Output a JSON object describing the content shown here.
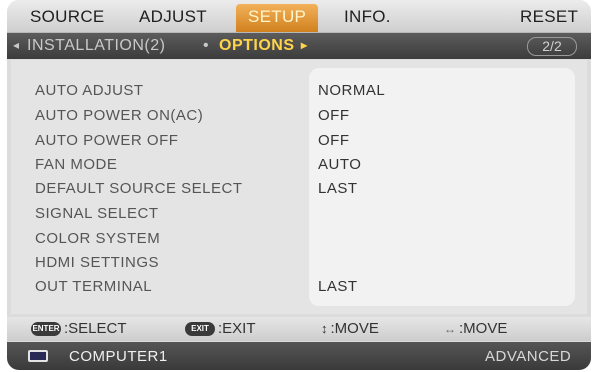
{
  "tabs": [
    "SOURCE",
    "ADJUST",
    "SETUP",
    "INFO.",
    "RESET"
  ],
  "active_tab": "SETUP",
  "subnav": {
    "left_arrow": "◂",
    "prev": "INSTALLATION(2)",
    "dot": "•",
    "current": "OPTIONS",
    "right_arrow": "▸",
    "page": "2/2"
  },
  "settings": [
    {
      "label": "AUTO ADJUST",
      "value": "NORMAL"
    },
    {
      "label": "AUTO POWER ON(AC)",
      "value": "OFF"
    },
    {
      "label": "AUTO POWER OFF",
      "value": "OFF"
    },
    {
      "label": "FAN MODE",
      "value": "AUTO"
    },
    {
      "label": "DEFAULT SOURCE SELECT",
      "value": "LAST"
    },
    {
      "label": "SIGNAL SELECT",
      "value": ""
    },
    {
      "label": "COLOR SYSTEM",
      "value": ""
    },
    {
      "label": "HDMI SETTINGS",
      "value": ""
    },
    {
      "label": "OUT TERMINAL",
      "value": "LAST"
    }
  ],
  "help": {
    "enter_key": "ENTER",
    "select": ":SELECT",
    "exit_key": "EXIT",
    "exit": ":EXIT",
    "updown_glyph": "↕",
    "move1": ":MOVE",
    "leftright_glyph": "↔",
    "move2": ":MOVE"
  },
  "status": {
    "source": "COMPUTER1",
    "level": "ADVANCED"
  },
  "colors": {
    "active_tab": "#e09a3a",
    "active_subnav": "#ffd34a"
  }
}
